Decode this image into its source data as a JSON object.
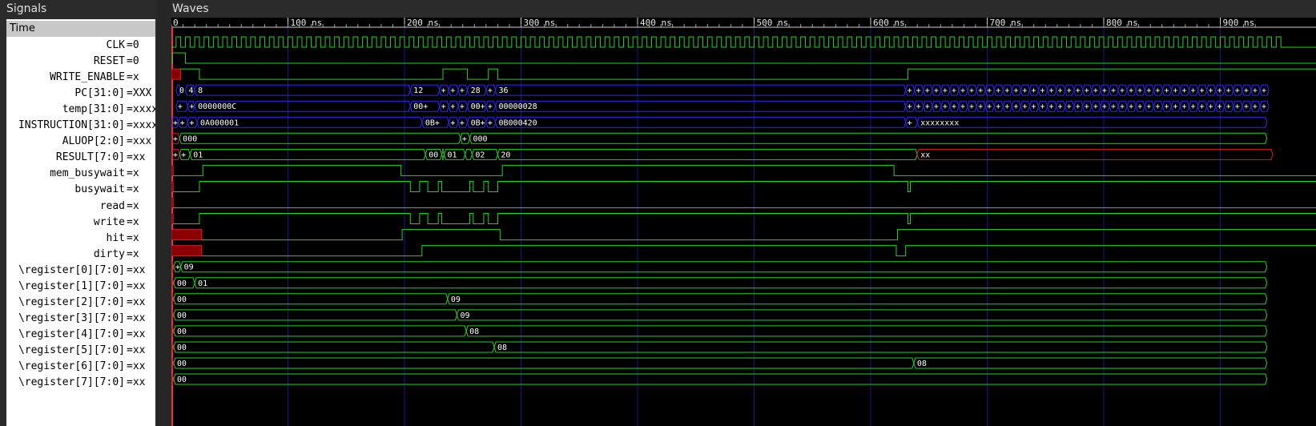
{
  "panels": {
    "signals_title": "Signals",
    "waves_title": "Waves",
    "time_header": "Time"
  },
  "colors": {
    "wave": "#22d322",
    "bus": "#2a2aff",
    "unknown": "#d42121",
    "grid": "#16168a",
    "cursor": "#ff3030"
  },
  "signals": [
    {
      "name": "CLK",
      "value": "=0",
      "wave": "clock"
    },
    {
      "name": "RESET",
      "value": "=0",
      "wave": "reset"
    },
    {
      "name": "WRITE_ENABLE",
      "value": "=x",
      "wave": "we"
    },
    {
      "name": "PC[31:0]",
      "value": "=XXX",
      "wave": "pc"
    },
    {
      "name": "temp[31:0]",
      "value": "=xxxxx",
      "wave": "temp"
    },
    {
      "name": "INSTRUCTION[31:0]",
      "value": "=xxxxx",
      "wave": "instr"
    },
    {
      "name": "ALUOP[2:0]",
      "value": "=xxx",
      "wave": "aluop"
    },
    {
      "name": "RESULT[7:0]",
      "value": "=xx",
      "wave": "result"
    },
    {
      "name": "mem_busywait",
      "value": "=x",
      "wave": "membusy"
    },
    {
      "name": "busywait",
      "value": "=x",
      "wave": "busy"
    },
    {
      "name": "read",
      "value": "=x",
      "wave": "read"
    },
    {
      "name": "write",
      "value": "=x",
      "wave": "write"
    },
    {
      "name": "hit",
      "value": "=x",
      "wave": "hit"
    },
    {
      "name": "dirty",
      "value": "=x",
      "wave": "dirty"
    },
    {
      "name": "\\register[0][7:0]",
      "value": "=xx",
      "wave": "r0"
    },
    {
      "name": "\\register[1][7:0]",
      "value": "=xx",
      "wave": "r1"
    },
    {
      "name": "\\register[2][7:0]",
      "value": "=xx",
      "wave": "r2"
    },
    {
      "name": "\\register[3][7:0]",
      "value": "=xx",
      "wave": "r3"
    },
    {
      "name": "\\register[4][7:0]",
      "value": "=xx",
      "wave": "r4"
    },
    {
      "name": "\\register[5][7:0]",
      "value": "=xx",
      "wave": "r5"
    },
    {
      "name": "\\register[6][7:0]",
      "value": "=xx",
      "wave": "r6"
    },
    {
      "name": "\\register[7][7:0]",
      "value": "=xx",
      "wave": "r7"
    }
  ],
  "timeline": {
    "start_label": "0",
    "ticks": [
      "100 ns",
      "200 ns",
      "300 ns",
      "400 ns",
      "500 ns",
      "600 ns",
      "700 ns",
      "800 ns",
      "900 ns"
    ],
    "visible_range_ns": [
      0,
      940
    ]
  },
  "bus_values": {
    "pc": [
      "0",
      "4",
      "8",
      "12",
      "28",
      "36"
    ],
    "temp": [
      "0000000C",
      "00+",
      "00+",
      "00000028"
    ],
    "instr": [
      "0A000001",
      "0B+",
      "0B+",
      "0B000420",
      "xxxxxxxx"
    ],
    "aluop": [
      "000",
      "000"
    ],
    "result": [
      "01",
      "00",
      "01",
      "02",
      "20",
      "xx"
    ],
    "r0": [
      "09"
    ],
    "r1": [
      "00",
      "01"
    ],
    "r2": [
      "00",
      "09"
    ],
    "r3": [
      "00",
      "09"
    ],
    "r4": [
      "00",
      "08"
    ],
    "r5": [
      "00",
      "08"
    ],
    "r6": [
      "00",
      "08"
    ],
    "r7": [
      "00"
    ]
  }
}
